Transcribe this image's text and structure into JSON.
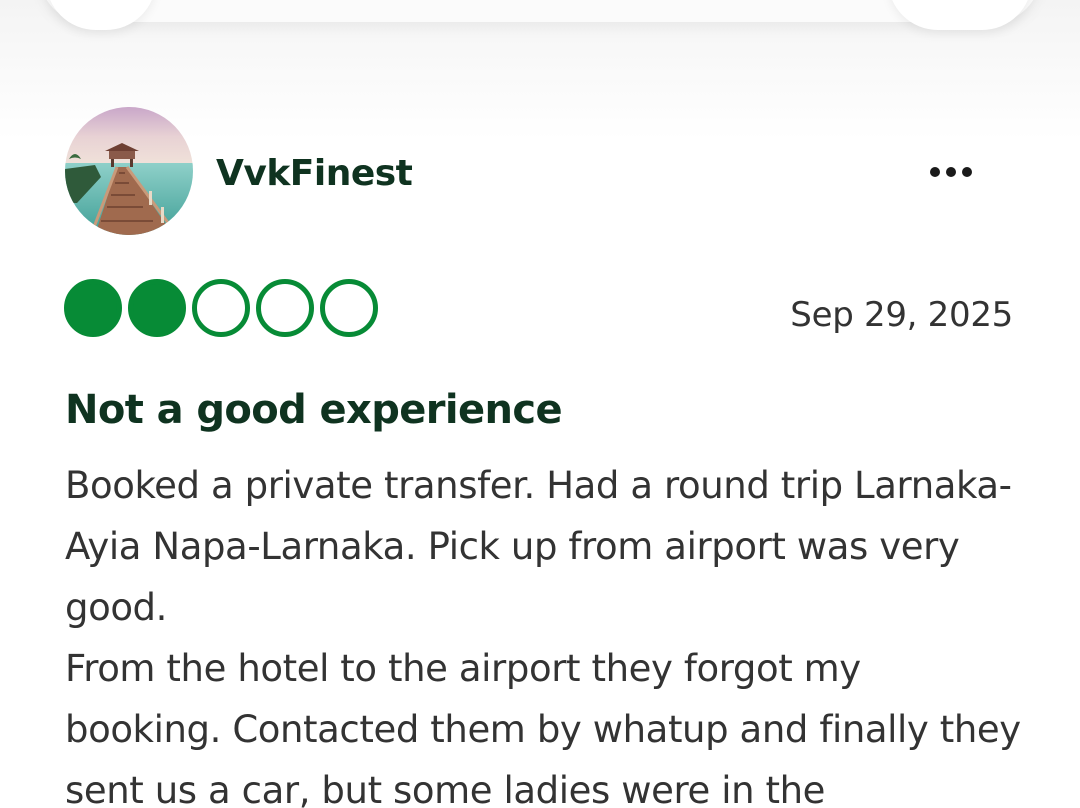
{
  "reviewer": {
    "name": "VvkFinest",
    "avatar": "avatar-photo-pier"
  },
  "menu": {
    "icon": "more-options-icon"
  },
  "review": {
    "rating": 2,
    "rating_max": 5,
    "date": "Sep 29, 2025",
    "title": "Not a good experience",
    "body": [
      "Booked a private transfer. Had a round trip Larnaka-Ayia Napa-Larnaka. Pick up from airport was very good.",
      "From the hotel to the airport they forgot my booking. Contacted them by whatup and finally they sent us a car, but some ladies were in the"
    ]
  },
  "colors": {
    "rating_green": "#078b36",
    "title_text": "#0f3320",
    "body_text": "#333333"
  }
}
